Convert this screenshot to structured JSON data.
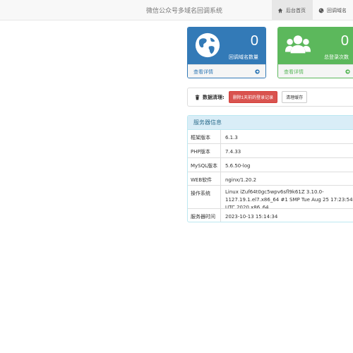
{
  "navbar": {
    "brand": "微信公众号多域名回调系统",
    "tabs": [
      {
        "label": "后台首页",
        "icon": "home-icon",
        "active": true
      },
      {
        "label": "回调域名",
        "icon": "globe-icon",
        "active": false
      }
    ]
  },
  "stats": [
    {
      "value": "0",
      "caption": "回调域名数量",
      "link": "查看详情",
      "icon": "globe-icon",
      "color": "#337ab7"
    },
    {
      "value": "0",
      "caption": "总登录次数",
      "link": "查看详情",
      "icon": "users-icon",
      "color": "#5cb85c"
    }
  ],
  "cleanup": {
    "label": "数据清理:",
    "delete_button": "删除1天前的登录记录",
    "clear_cache_button": "清理缓存"
  },
  "server_info": {
    "title": "服务器信息",
    "rows": [
      {
        "key": "框架版本",
        "value": "6.1.3"
      },
      {
        "key": "PHP版本",
        "value": "7.4.33"
      },
      {
        "key": "MySQL版本",
        "value": "5.6.50-log"
      },
      {
        "key": "WEB软件",
        "value": "nginx/1.20.2"
      },
      {
        "key": "操作系统",
        "value": "Linux iZuf64t0gc5wpv6sfl9k61Z 3.10.0-1127.19.1.el7.x86_64 #1 SMP Tue Aug 25 17:23:54 UTC 2020 x86_64"
      },
      {
        "key": "服务器时间",
        "value": "2023-10-13 15:14:34"
      }
    ]
  }
}
